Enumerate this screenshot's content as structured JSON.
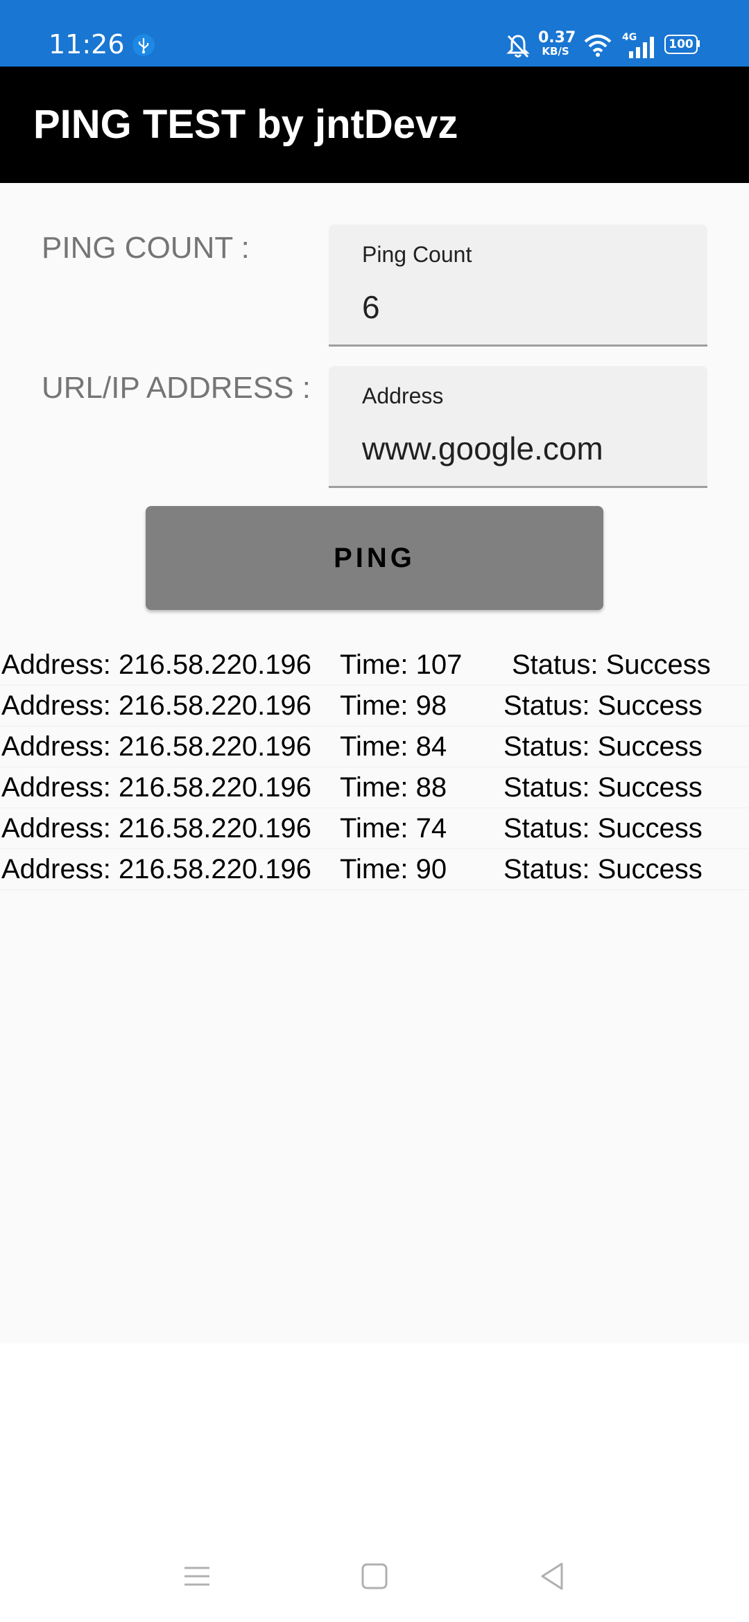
{
  "status_bar": {
    "time": "11:26",
    "net_speed_value": "0.37",
    "net_speed_unit": "KB/S",
    "network_type": "4G",
    "battery": "100"
  },
  "app_bar": {
    "title": "PING TEST by jntDevz"
  },
  "form": {
    "ping_count_label": "PING COUNT :",
    "ping_count_hint": "Ping Count",
    "ping_count_value": "6",
    "address_label": "URL/IP ADDRESS :",
    "address_hint": "Address",
    "address_value": "www.google.com"
  },
  "ping_button": {
    "label": "PING"
  },
  "results": [
    {
      "address": "Address: 216.58.220.196",
      "time": "Time: 107",
      "status": "Status: Success"
    },
    {
      "address": "Address: 216.58.220.196",
      "time": "Time: 98",
      "status": "Status: Success"
    },
    {
      "address": "Address: 216.58.220.196",
      "time": "Time: 84",
      "status": "Status: Success"
    },
    {
      "address": "Address: 216.58.220.196",
      "time": "Time: 88",
      "status": "Status: Success"
    },
    {
      "address": "Address: 216.58.220.196",
      "time": "Time: 74",
      "status": "Status: Success"
    },
    {
      "address": "Address: 216.58.220.196",
      "time": "Time: 90",
      "status": "Status: Success"
    }
  ],
  "nav_bar": {
    "icons": [
      "menu-icon",
      "home-square-icon",
      "back-triangle-icon"
    ]
  },
  "colors": {
    "status_bar": "#1976d2",
    "app_bar": "#000000",
    "button": "#808080",
    "background": "#fafafa"
  }
}
